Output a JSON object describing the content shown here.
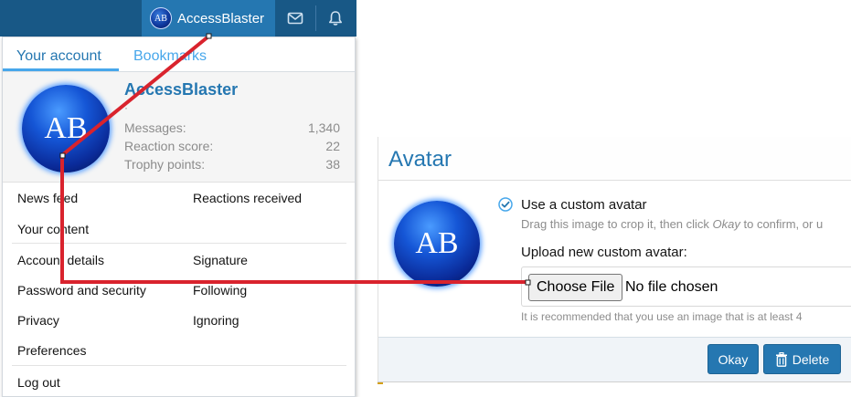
{
  "topbar": {
    "username": "AccessBlaster",
    "avatar_initials": "AB",
    "icons": [
      "envelope-icon",
      "bell-icon"
    ]
  },
  "account_menu": {
    "tabs": [
      {
        "label": "Your account",
        "active": true
      },
      {
        "label": "Bookmarks",
        "active": false
      }
    ],
    "profile": {
      "name": "AccessBlaster",
      "title_dot": "·",
      "avatar_initials": "AB",
      "stats": [
        {
          "label": "Messages:",
          "value": "1,340"
        },
        {
          "label": "Reaction score:",
          "value": "22"
        },
        {
          "label": "Trophy points:",
          "value": "38"
        }
      ]
    },
    "links": {
      "news_feed": "News feed",
      "reactions_received": "Reactions received",
      "your_content": "Your content",
      "account_details": "Account details",
      "signature": "Signature",
      "password_security": "Password and security",
      "following": "Following",
      "privacy": "Privacy",
      "ignoring": "Ignoring",
      "preferences": "Preferences",
      "log_out": "Log out"
    }
  },
  "avatar_panel": {
    "title": "Avatar",
    "avatar_initials": "AB",
    "custom_option_label": "Use a custom avatar",
    "custom_option_hint_prefix": "Drag this image to crop it, then click ",
    "custom_option_hint_em": "Okay",
    "custom_option_hint_suffix": " to confirm, or u",
    "upload_label": "Upload new custom avatar:",
    "choose_file_label": "Choose File",
    "no_file_text": "No file chosen",
    "recommendation": "It is recommended that you use an image that is at least 4",
    "okay_label": "Okay",
    "delete_label": "Delete"
  },
  "colors": {
    "topbar_bg": "#185886",
    "topbar_active": "#2577b1",
    "link_blue": "#2577b1",
    "tab_blue": "#47a7eb",
    "annotation_red": "#d9232d"
  }
}
